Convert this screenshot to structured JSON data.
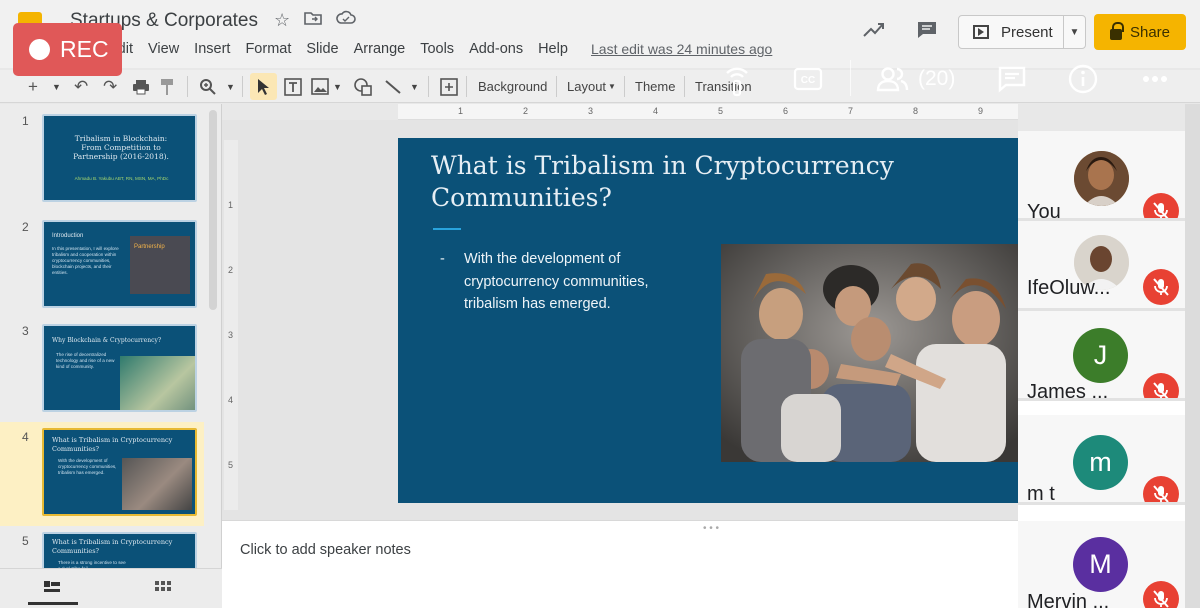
{
  "recording": {
    "label": "REC"
  },
  "doc": {
    "title": "Startups & Corporates",
    "menu": [
      "Edit",
      "View",
      "Insert",
      "Format",
      "Slide",
      "Arrange",
      "Tools",
      "Add-ons",
      "Help"
    ],
    "last_edit": "Last edit was 24 minutes ago"
  },
  "header": {
    "present_label": "Present",
    "share_label": "Share"
  },
  "toolbar": {
    "background": "Background",
    "layout": "Layout",
    "theme": "Theme",
    "transition": "Transition"
  },
  "meet": {
    "participant_count": "(20)"
  },
  "ruler": {
    "h_ticks": [
      "1",
      "2",
      "3",
      "4",
      "5",
      "6",
      "7",
      "8",
      "9"
    ],
    "v_ticks": [
      "1",
      "2",
      "3",
      "4",
      "5"
    ]
  },
  "filmstrip": {
    "slides": [
      {
        "num": "1",
        "title": "Tribalism in Blockchain: From Competition to Partnership (2016-2018).",
        "text": "Ahmadu B. Yakubu ABT, RN, MSN, MA, PhDc"
      },
      {
        "num": "2",
        "title": "Introduction",
        "text": "In this presentation, I will explore tribalism and cooperation within cryptocurrency communities, blockchain projects, and their entities.",
        "badge": "Partnership"
      },
      {
        "num": "3",
        "title": "Why Blockchain & Cryptocurrency?",
        "text": "The rise of decentralized technology and rise of a new kind of community."
      },
      {
        "num": "4",
        "title": "What is Tribalism in Cryptocurrency Communities?",
        "text": "With the development of cryptocurrency communities, tribalism has emerged."
      },
      {
        "num": "5",
        "title": "What is Tribalism in Cryptocurrency Communities?",
        "text": "There is a strong incentive to see a rival tribe fail."
      }
    ]
  },
  "slide": {
    "title": "What is Tribalism in Cryptocurrency Communities?",
    "bullet": "With the development of cryptocurrency communities, tribalism has emerged."
  },
  "notes": {
    "placeholder": "Click to add speaker notes"
  },
  "participants": [
    {
      "name": "You",
      "avatar": "",
      "color": "#c9a27a"
    },
    {
      "name": "IfeOluw...",
      "avatar": "",
      "color": "#d8d2c8"
    },
    {
      "name": "James ...",
      "avatar": "J",
      "color": "#3c7d2a"
    },
    {
      "name": "m t",
      "avatar": "m",
      "color": "#1d8a7a"
    },
    {
      "name": "Mervin ...",
      "avatar": "M",
      "color": "#5a2fa0"
    }
  ],
  "colors": {
    "slide_bg": "#0b5178",
    "accent": "#29a3dd",
    "share": "#f5b400",
    "rec": "#e05858",
    "mute": "#e84133"
  }
}
